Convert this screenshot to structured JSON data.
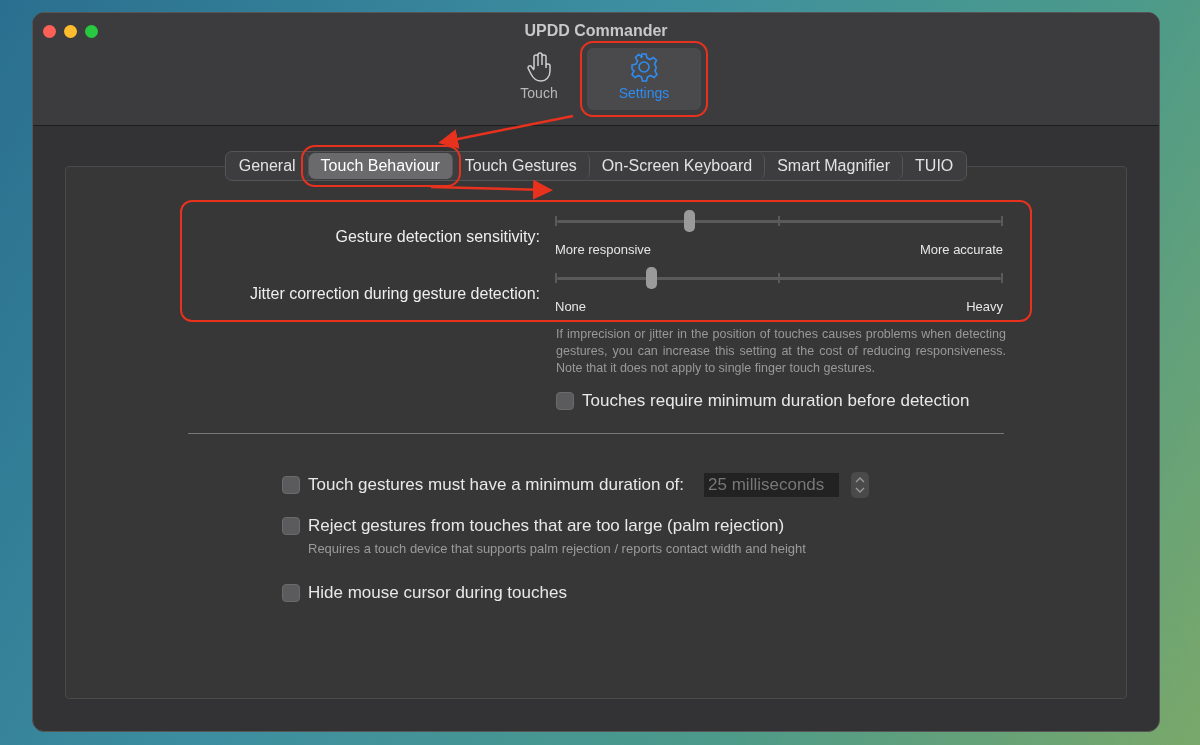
{
  "window": {
    "title": "UPDD Commander"
  },
  "toolbar": [
    {
      "label": "Touch",
      "selected": false
    },
    {
      "label": "Settings",
      "selected": true
    }
  ],
  "tabs": [
    {
      "label": "General",
      "selected": false
    },
    {
      "label": "Touch Behaviour",
      "selected": true
    },
    {
      "label": "Touch Gestures",
      "selected": false
    },
    {
      "label": "On-Screen Keyboard",
      "selected": false
    },
    {
      "label": "Smart Magnifier",
      "selected": false
    },
    {
      "label": "TUIO",
      "selected": false
    }
  ],
  "sliders": [
    {
      "label": "Gesture detection sensitivity:",
      "min_label": "More responsive",
      "max_label": "More accurate",
      "level": 0.3
    },
    {
      "label": "Jitter correction during gesture detection:",
      "min_label": "None",
      "max_label": "Heavy",
      "level": 0.215
    }
  ],
  "jitter_note": "If imprecision or jitter in the position of touches causes problems when detecting gestures, you can increase this setting at the cost of reducing responsiveness. Note that it does not apply to single finger touch gestures.",
  "minimum_duration_check": {
    "label": "Touches require minimum duration before detection",
    "checked": false
  },
  "options": [
    {
      "kind": "duration",
      "label": "Touch gestures must have a minimum duration of:",
      "checked": false,
      "value": "25 milliseconds"
    },
    {
      "kind": "note",
      "label": "Reject gestures from touches that are too large (palm rejection)",
      "checked": false,
      "note": "Requires a touch device that supports palm rejection / reports contact width and height"
    },
    {
      "kind": "plain",
      "label": "Hide mouse cursor during touches",
      "checked": false
    }
  ]
}
